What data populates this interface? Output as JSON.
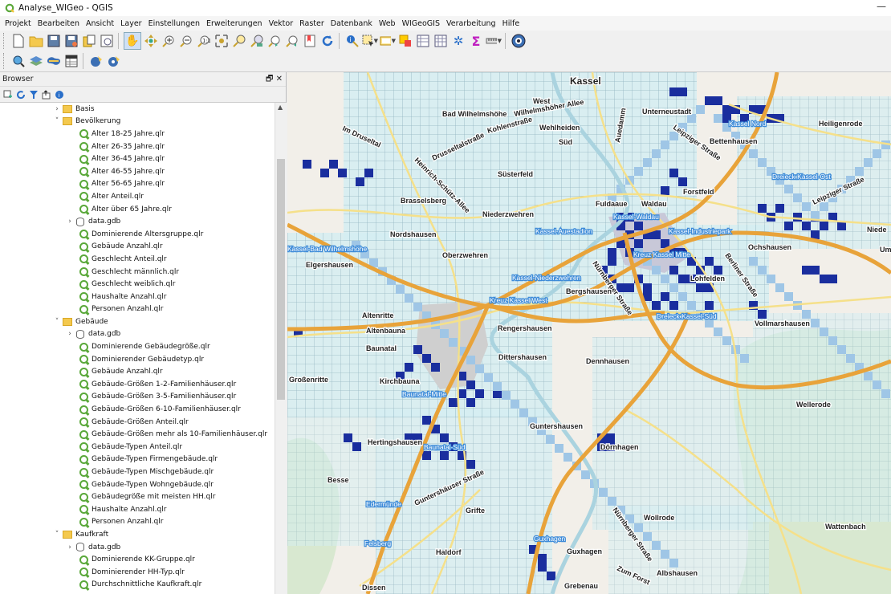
{
  "window": {
    "title": "Analyse_WIGeo - QGIS",
    "minimize": "—"
  },
  "menu": [
    "Projekt",
    "Bearbeiten",
    "Ansicht",
    "Layer",
    "Einstellungen",
    "Erweiterungen",
    "Vektor",
    "Raster",
    "Datenbank",
    "Web",
    "WIGeoGIS",
    "Verarbeitung",
    "Hilfe"
  ],
  "toolbar_icons": [
    "new-project-icon",
    "open-project-icon",
    "save-project-icon",
    "save-as-icon",
    "project-templates-icon",
    "print-layout-icon",
    "pan-icon",
    "pan-to-selection-icon",
    "zoom-in-icon",
    "zoom-out-icon",
    "zoom-native-icon",
    "zoom-full-icon",
    "zoom-to-selection-icon",
    "zoom-to-layer-icon",
    "zoom-last-icon",
    "zoom-next-icon",
    "new-bookmark-icon",
    "refresh-icon",
    "identify-icon",
    "select-features-icon",
    "deselect-icon",
    "open-attribute-table-icon",
    "field-calculator-icon",
    "statistics-icon",
    "sum-icon",
    "measure-icon",
    "map-tips-icon"
  ],
  "browser_panel": {
    "title": "Browser",
    "buttons": "🗗 ✕",
    "items": [
      {
        "indent": 0,
        "expander": "›",
        "type": "folder",
        "label": "Basis"
      },
      {
        "indent": 0,
        "expander": "⌄",
        "type": "folder",
        "label": "Bevölkerung"
      },
      {
        "indent": 1,
        "expander": "",
        "type": "qlr",
        "label": "Alter 18-25 Jahre.qlr"
      },
      {
        "indent": 1,
        "expander": "",
        "type": "qlr",
        "label": "Alter 26-35 Jahre.qlr"
      },
      {
        "indent": 1,
        "expander": "",
        "type": "qlr",
        "label": "Alter 36-45 Jahre.qlr"
      },
      {
        "indent": 1,
        "expander": "",
        "type": "qlr",
        "label": "Alter 46-55 Jahre.qlr"
      },
      {
        "indent": 1,
        "expander": "",
        "type": "qlr",
        "label": "Alter 56-65 Jahre.qlr"
      },
      {
        "indent": 1,
        "expander": "",
        "type": "qlr",
        "label": "Alter Anteil.qlr"
      },
      {
        "indent": 1,
        "expander": "",
        "type": "qlr",
        "label": "Alter über 65 Jahre.qlr"
      },
      {
        "indent": 1,
        "expander": "›",
        "type": "db",
        "label": "data.gdb"
      },
      {
        "indent": 1,
        "expander": "",
        "type": "qlr",
        "label": "Dominierende Altersgruppe.qlr"
      },
      {
        "indent": 1,
        "expander": "",
        "type": "qlr",
        "label": "Gebäude Anzahl.qlr"
      },
      {
        "indent": 1,
        "expander": "",
        "type": "qlr",
        "label": "Geschlecht Anteil.qlr"
      },
      {
        "indent": 1,
        "expander": "",
        "type": "qlr",
        "label": "Geschlecht männlich.qlr"
      },
      {
        "indent": 1,
        "expander": "",
        "type": "qlr",
        "label": "Geschlecht weiblich.qlr"
      },
      {
        "indent": 1,
        "expander": "",
        "type": "qlr",
        "label": "Haushalte Anzahl.qlr"
      },
      {
        "indent": 1,
        "expander": "",
        "type": "qlr",
        "label": "Personen Anzahl.qlr"
      },
      {
        "indent": 0,
        "expander": "⌄",
        "type": "folder",
        "label": "Gebäude"
      },
      {
        "indent": 1,
        "expander": "›",
        "type": "db",
        "label": "data.gdb"
      },
      {
        "indent": 1,
        "expander": "",
        "type": "qlr",
        "label": "Dominierende Gebäudegröße.qlr"
      },
      {
        "indent": 1,
        "expander": "",
        "type": "qlr",
        "label": "Dominierender Gebäudetyp.qlr"
      },
      {
        "indent": 1,
        "expander": "",
        "type": "qlr",
        "label": "Gebäude Anzahl.qlr"
      },
      {
        "indent": 1,
        "expander": "",
        "type": "qlr",
        "label": "Gebäude-Größen 1-2-Familienhäuser.qlr"
      },
      {
        "indent": 1,
        "expander": "",
        "type": "qlr",
        "label": "Gebäude-Größen 3-5-Familienhäuser.qlr"
      },
      {
        "indent": 1,
        "expander": "",
        "type": "qlr",
        "label": "Gebäude-Größen 6-10-Familienhäuser.qlr"
      },
      {
        "indent": 1,
        "expander": "",
        "type": "qlr",
        "label": "Gebäude-Größen Anteil.qlr"
      },
      {
        "indent": 1,
        "expander": "",
        "type": "qlr",
        "label": "Gebäude-Größen mehr als 10-Familienhäuser.qlr"
      },
      {
        "indent": 1,
        "expander": "",
        "type": "qlr",
        "label": "Gebäude-Typen Anteil.qlr"
      },
      {
        "indent": 1,
        "expander": "",
        "type": "qlr",
        "label": "Gebäude-Typen Firmengebäude.qlr"
      },
      {
        "indent": 1,
        "expander": "",
        "type": "qlr",
        "label": "Gebäude-Typen Mischgebäude.qlr"
      },
      {
        "indent": 1,
        "expander": "",
        "type": "qlr",
        "label": "Gebäude-Typen Wohngebäude.qlr"
      },
      {
        "indent": 1,
        "expander": "",
        "type": "qlr",
        "label": "Gebäudegröße mit meisten HH.qlr"
      },
      {
        "indent": 1,
        "expander": "",
        "type": "qlr",
        "label": "Haushalte Anzahl.qlr"
      },
      {
        "indent": 1,
        "expander": "",
        "type": "qlr",
        "label": "Personen Anzahl.qlr"
      },
      {
        "indent": 0,
        "expander": "⌄",
        "type": "folder",
        "label": "Kaufkraft"
      },
      {
        "indent": 1,
        "expander": "›",
        "type": "db",
        "label": "data.gdb"
      },
      {
        "indent": 1,
        "expander": "",
        "type": "qlr",
        "label": "Dominierende KK-Gruppe.qlr"
      },
      {
        "indent": 1,
        "expander": "",
        "type": "qlr",
        "label": "Dominierender HH-Typ.qlr"
      },
      {
        "indent": 1,
        "expander": "",
        "type": "qlr",
        "label": "Durchschnittliche Kaufkraft.qlr"
      }
    ]
  },
  "map": {
    "labels": {
      "kassel": "Kassel",
      "west": "West",
      "bad_wilhelmshoehe": "Bad Wilhelmshöhe",
      "wilhelmshoeher_allee": "Wilhelmshöher Allee",
      "unterneustadt": "Unterneustadt",
      "heiligenrode": "Heiligenrode",
      "im_druseltal": "Im Druseltal",
      "drusselstrasse": "Drusseltalstraße",
      "kohlenstrasse": "Kohlenstraße",
      "wehlheiden": "Wehlheiden",
      "sued": "Süd",
      "auedamm": "Auedamm",
      "leipziger_strasse_1": "Leipziger Straße",
      "bettenhausen": "Bettenhausen",
      "heinrich_schuetz": "Heinrich-Schütz-Allee",
      "suesterfeld": "Süsterfeld",
      "forstfeld": "Forstfeld",
      "brasselsberg": "Brasselsberg",
      "fuldaaue": "Fuldaaue",
      "waldau": "Waldau",
      "niederzwehren": "Niederzwehren",
      "leipziger_strasse_2": "Leipziger Straße",
      "niede": "Niede",
      "nordshausen": "Nordshausen",
      "oberzwehren": "Oberzwehren",
      "ochshausen": "Ochshausen",
      "um": "Um",
      "elgershausen": "Elgershausen",
      "nuernberger": "Nürnberger Straße",
      "berliner": "Berliner Straße",
      "lohfelden": "Lohfelden",
      "bergshausen": "Bergshausen",
      "altenritte": "Altenritte",
      "altenbauna": "Altenbauna",
      "rengershausen": "Rengershausen",
      "vollmarshausen": "Vollmarshausen",
      "baunatal": "Baunatal",
      "dittershausen": "Dittershausen",
      "dennhausen": "Dennhausen",
      "grossenritte": "Großenritte",
      "kirchbauna": "Kirchbauna",
      "wellerode": "Wellerode",
      "guntershausen": "Guntershausen",
      "hertingshausen": "Hertingshausen",
      "doernhagen": "Dörnhagen",
      "besse": "Besse",
      "guntershaeuser": "Guntershäuser Straße",
      "grifte": "Grifte",
      "wollrode": "Wollrode",
      "nuernberger2": "Nürnberger Straße",
      "wattenbach": "Wattenbach",
      "guxhagen": "Guxhagen",
      "zum_forst": "Zum Forst",
      "albshausen": "Albshausen",
      "haldorf": "Haldorf",
      "dissen": "Dissen",
      "grebenau": "Grebenau"
    },
    "blue_labels": {
      "kassel_nord": "Kassel Nord",
      "dreieck_ost": "Dreieck Kassel-Ost",
      "kassel_waldau": "Kassel-Waldau",
      "auestadion": "Kassel-Auestadion",
      "industriepark": "Kassel-Industriepark",
      "bad_wilhelmshoehe": "Kassel-Bad Wilhelmshöhe",
      "kassel_mitte": "Kreuz Kassel Mitte",
      "niederzwehren": "Kassel-Niederzwehren",
      "kreuz_west": "Kreuz Kassel West",
      "dreieck_sued": "Dreieck Kassel-Süd",
      "baunatal_mitte": "Baunatal-Mitte",
      "baunatal_sued": "Baunatal-Süd",
      "edermuende": "Edermünde",
      "felsberg": "Felsberg",
      "guxhagen": "Guxhagen"
    },
    "colors": {
      "grid_light": "#d4eef2",
      "grid_mid": "#9fc6e6",
      "grid_dark": "#1a2e9e",
      "grid_line": "#7fa8b8",
      "motorway": "#e8a33a",
      "road": "#f5e08a",
      "water": "#aad3df",
      "forest": "#d8e8d0"
    }
  }
}
